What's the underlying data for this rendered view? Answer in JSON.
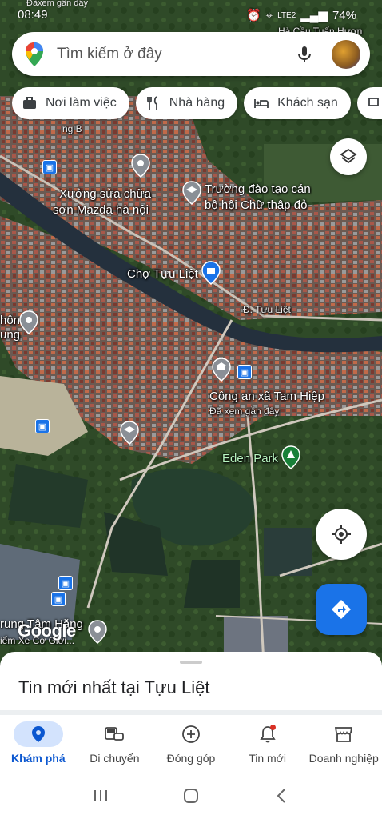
{
  "status": {
    "top_text": "Đãxem gần đây",
    "time": "08:49",
    "signal": "LTE2",
    "battery": "74%"
  },
  "search": {
    "placeholder": "Tìm kiếm ở đây"
  },
  "chips": [
    {
      "label": "Nơi làm việc",
      "icon": "briefcase-icon"
    },
    {
      "label": "Nhà hàng",
      "icon": "restaurant-icon"
    },
    {
      "label": "Khách sạn",
      "icon": "hotel-icon"
    }
  ],
  "map": {
    "labels": {
      "corner_top": "Hà Cầu Tuấn Hươn",
      "road_b": "ng B",
      "mazda": "Xưởng sửa chữa\nsơn Mazda hà nội",
      "school_line1": "Trường đào tạo cán",
      "school_line2": "bộ hội Chữ thập đỏ",
      "market": "Chợ Tựu Liệt",
      "street": "Đ. Tựu Liệt",
      "left_place1": "hôn",
      "left_place2": "ung",
      "police": "Công an xã Tam Hiệp",
      "police_sub": "Đã xem gần đây",
      "park": "Eden Park",
      "bottom_left1": "rung Tâm Hăng",
      "bottom_left2": "iểm Xe Cơ Giới...",
      "google": "Google"
    }
  },
  "sheet": {
    "title": "Tin mới nhất tại Tựu Liệt"
  },
  "nav": [
    {
      "label": "Khám phá",
      "icon": "explore-pin-icon",
      "active": true
    },
    {
      "label": "Di chuyển",
      "icon": "commute-icon"
    },
    {
      "label": "Đóng góp",
      "icon": "add-circle-icon"
    },
    {
      "label": "Tin mới",
      "icon": "bell-icon"
    },
    {
      "label": "Doanh nghiệp",
      "icon": "storefront-icon"
    }
  ],
  "colors": {
    "accent": "#1a73e8",
    "nav_active_bg": "#d3e3fd",
    "badge": "#d93025"
  }
}
